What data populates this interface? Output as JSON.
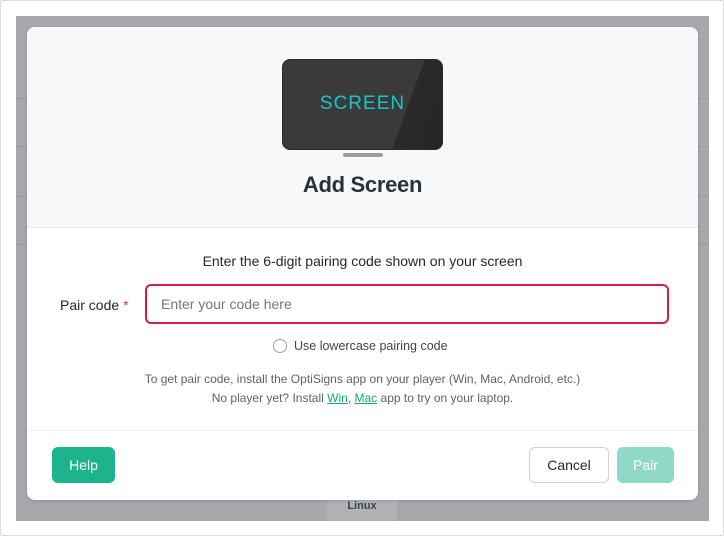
{
  "modal": {
    "screen_art_label": "SCREEN",
    "title": "Add Screen",
    "instruction": "Enter the 6-digit pairing code shown on your screen",
    "pair_code": {
      "label": "Pair code",
      "required_mark": "*",
      "value": "",
      "placeholder": "Enter your code here"
    },
    "lowercase_option": {
      "label": "Use lowercase pairing code",
      "checked": false
    },
    "help_text": {
      "line1": "To get pair code, install the OptiSigns app on your player (Win, Mac, Android, etc.)",
      "line2_prefix": "No player yet? Install",
      "win_link": "Win",
      "separator": ",",
      "mac_link": "Mac",
      "line2_suffix": "app to try on your laptop."
    },
    "buttons": {
      "help": "Help",
      "cancel": "Cancel",
      "pair": "Pair"
    }
  },
  "background": {
    "platform_label": "Linux"
  },
  "colors": {
    "accent": "#1cb38d",
    "accent_disabled": "#8fd9c6",
    "error_border": "#d51c4d",
    "link": "#1aa77e",
    "screen_text": "#19c5c7"
  }
}
